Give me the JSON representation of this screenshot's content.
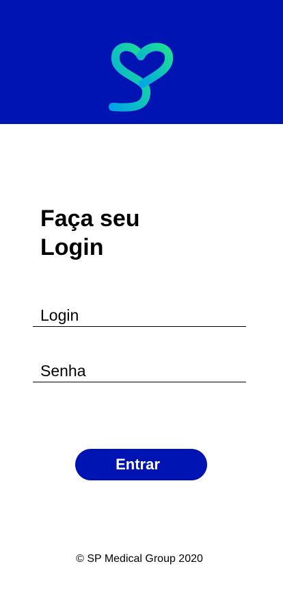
{
  "header": {
    "background_color": "#0014b4",
    "logo": {
      "icon": "heart-s-logo-icon",
      "gradient": [
        "#00a6e6",
        "#1fe090"
      ]
    }
  },
  "main": {
    "title_line1": "Faça seu",
    "title_line2": "Login",
    "login_field": {
      "placeholder": "Login",
      "value": ""
    },
    "password_field": {
      "placeholder": "Senha",
      "value": ""
    },
    "submit_button": {
      "label": "Entrar",
      "color": "#0014b4"
    }
  },
  "footer": {
    "copyright": "© SP Medical Group 2020"
  }
}
